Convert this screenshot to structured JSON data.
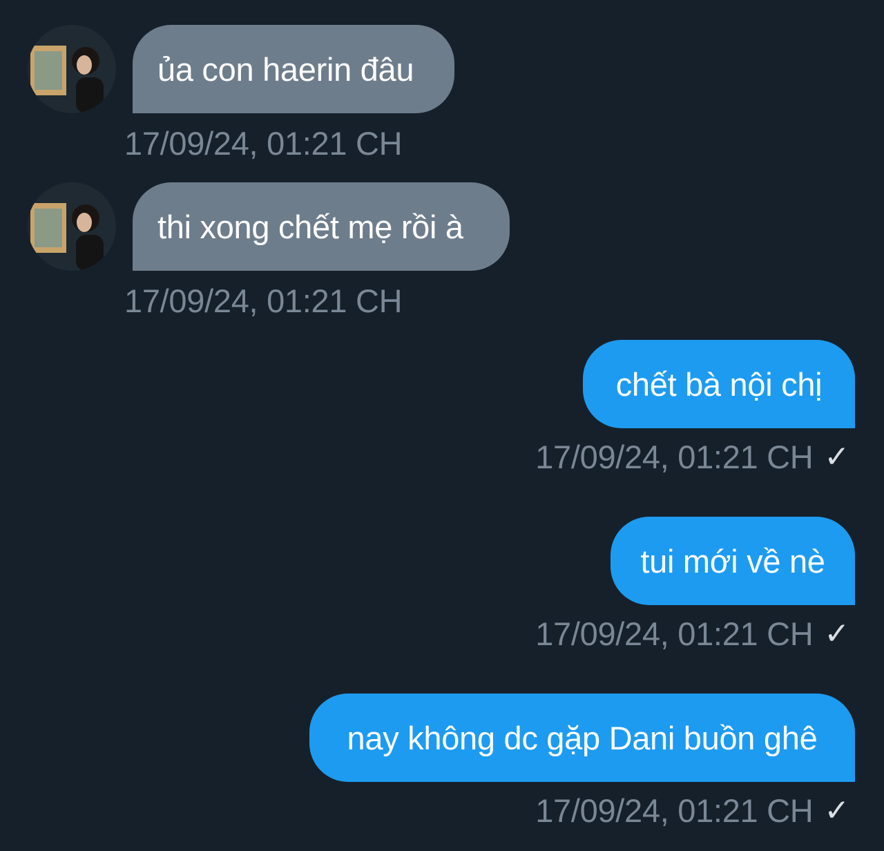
{
  "messages": [
    {
      "direction": "incoming",
      "text": "ủa con haerin đâu",
      "time": "17/09/24, 01:21 CH",
      "avatar": "contact-avatar"
    },
    {
      "direction": "incoming",
      "text": "thi xong chết mẹ rồi à",
      "time": "17/09/24, 01:21 CH",
      "avatar": "contact-avatar"
    },
    {
      "direction": "outgoing",
      "text": "chết bà nội chị",
      "time": "17/09/24, 01:21 CH",
      "status_icon": "check-icon"
    },
    {
      "direction": "outgoing",
      "text": "tui mới về nè",
      "time": "17/09/24, 01:21 CH",
      "status_icon": "check-icon"
    },
    {
      "direction": "outgoing",
      "text": "nay không dc gặp Dani buồn ghê",
      "time": "17/09/24, 01:21 CH",
      "status_icon": "check-icon"
    }
  ],
  "theme": {
    "background": "#16202b",
    "incoming_bubble": "#6e7d8c",
    "outgoing_bubble": "#1d9bf0",
    "timestamp_color": "#7a8794"
  },
  "check_glyph": "✓"
}
